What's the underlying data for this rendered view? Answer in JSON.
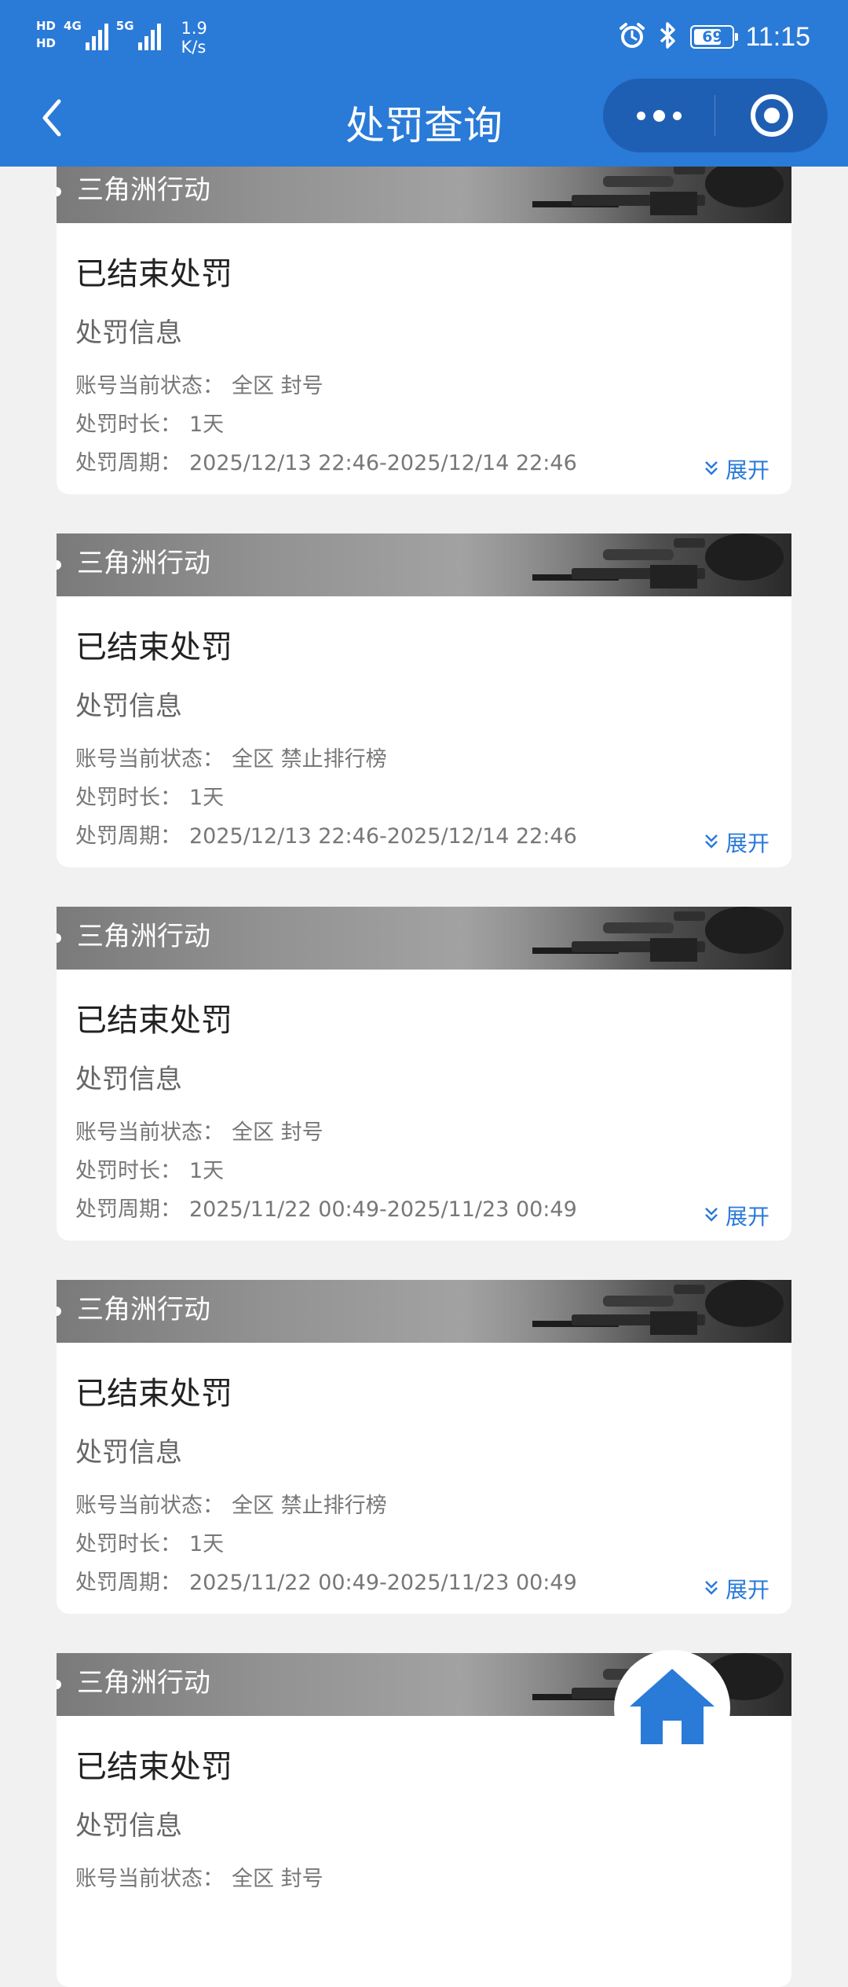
{
  "status_bar": {
    "hd1": "HD",
    "hd2": "HD",
    "net1": "4G",
    "net2": "5G",
    "speed_value": "1.9",
    "speed_unit": "K/s",
    "battery": "69",
    "time": "11:15"
  },
  "nav": {
    "title": "处罚查询"
  },
  "labels": {
    "account_status": "账号当前状态：",
    "duration": "处罚时长：",
    "period": "处罚周期：",
    "section": "处罚信息",
    "expand": "展开"
  },
  "records": [
    {
      "game": "三角洲行动",
      "status": "已结束处罚",
      "account_status": "全区 封号",
      "duration": "1天",
      "period": "2025/12/13 22:46-2025/12/14 22:46"
    },
    {
      "game": "三角洲行动",
      "status": "已结束处罚",
      "account_status": "全区 禁止排行榜",
      "duration": "1天",
      "period": "2025/12/13 22:46-2025/12/14 22:46"
    },
    {
      "game": "三角洲行动",
      "status": "已结束处罚",
      "account_status": "全区 封号",
      "duration": "1天",
      "period": "2025/11/22 00:49-2025/11/23 00:49"
    },
    {
      "game": "三角洲行动",
      "status": "已结束处罚",
      "account_status": "全区 禁止排行榜",
      "duration": "1天",
      "period": "2025/11/22 00:49-2025/11/23 00:49"
    },
    {
      "game": "三角洲行动",
      "status": "已结束处罚",
      "account_status": "全区 封号",
      "duration": "",
      "period": ""
    }
  ],
  "icons": {
    "back": "chevron-left-icon",
    "more": "more-dots-icon",
    "close": "target-circle-icon",
    "expand": "double-chevron-down-icon",
    "home": "home-icon"
  },
  "colors": {
    "primary": "#2a7ad8",
    "capsule": "#1f5fb3",
    "background": "#f1f1f1"
  }
}
